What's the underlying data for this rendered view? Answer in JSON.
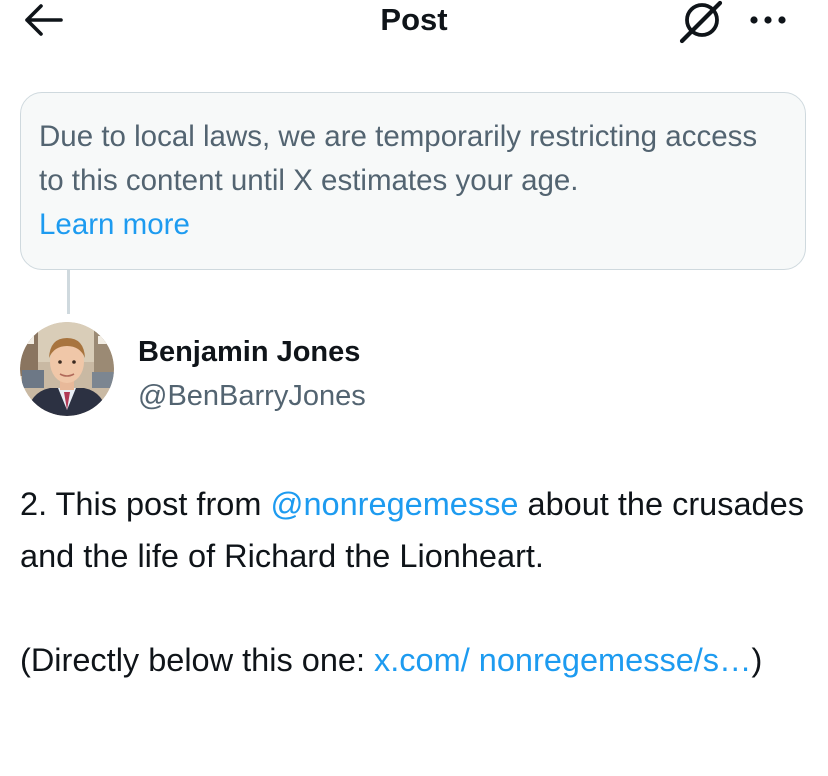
{
  "header": {
    "title": "Post",
    "back_icon": "arrow-left-icon",
    "grok_icon": "grok-icon",
    "more_icon": "more-horizontal-icon"
  },
  "notice": {
    "text": "Due to local laws, we are temporarily restricting access to this content until X estimates your age.",
    "link_label": "Learn more"
  },
  "author": {
    "name": "Benjamin Jones",
    "handle": "@BenBarryJones"
  },
  "post": {
    "line1_prefix": "2. This post from ",
    "mention": "@nonregemesse",
    "line1_suffix": " about the crusades and the life of Richard the Lionheart.",
    "line2_prefix": "(Directly below this one: ",
    "url": "x.com/ nonregemesse/s…",
    "line2_suffix": ")"
  },
  "colors": {
    "accent": "#1d9bf0",
    "secondary_text": "#536471",
    "notice_bg": "#f7f9f9",
    "border": "#cfd9de"
  }
}
